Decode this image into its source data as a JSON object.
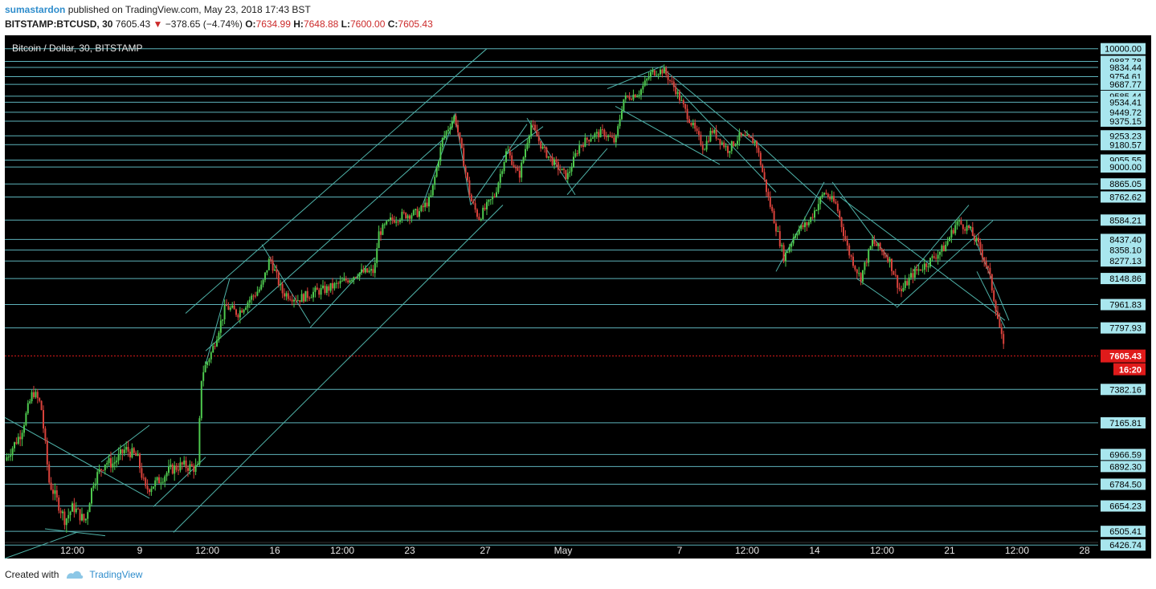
{
  "header": {
    "username": "sumastardon",
    "published_text": "published on TradingView.com, May 23, 2018 17:43 BST",
    "symbol": "BITSTAMP:BTCUSD, 30",
    "last": "7605.43",
    "change": "−378.65 (−4.74%)",
    "o_label": "O:",
    "o_value": "7634.99",
    "h_label": "H:",
    "h_value": "7648.88",
    "l_label": "L:",
    "l_value": "7600.00",
    "c_label": "C:",
    "c_value": "7605.43"
  },
  "footer": {
    "created_with": "Created with",
    "brand": "TradingView"
  },
  "colors": {
    "background": "#000000",
    "level_line": "#6fd3dc",
    "trend_line": "#4fb3a9",
    "label_bg": "#a8e6ee",
    "up": "#4ec94e",
    "down": "#d9423b",
    "price_tag": "#e01b1b"
  },
  "chart_data": {
    "type": "candlestick",
    "title": "Bitcoin / Dollar, 30, BITSTAMP",
    "ylim": [
      6350,
      10120
    ],
    "current_price": "7605.43",
    "countdown": "16:20",
    "price_levels": [
      "10000.00",
      "9887.78",
      "9834.44",
      "9754.61",
      "9687.77",
      "9585.44",
      "9534.41",
      "9449.72",
      "9375.15",
      "9253.23",
      "9180.57",
      "9055.55",
      "9000.00",
      "8865.05",
      "8762.62",
      "8584.21",
      "8437.40",
      "8358.10",
      "8277.13",
      "8148.86",
      "7961.83",
      "7797.93",
      "7382.16",
      "7165.81",
      "6966.59",
      "6892.30",
      "6784.50",
      "6654.23",
      "6505.41",
      "6426.74"
    ],
    "x_ticks": [
      "12:00",
      "9",
      "12:00",
      "16",
      "12:00",
      "23",
      "27",
      "May",
      "7",
      "12:00",
      "14",
      "12:00",
      "21",
      "12:00",
      "28"
    ],
    "price_path": [
      [
        0.0,
        6930
      ],
      [
        0.02,
        7100
      ],
      [
        0.035,
        7370
      ],
      [
        0.045,
        7280
      ],
      [
        0.055,
        6800
      ],
      [
        0.075,
        6570
      ],
      [
        0.085,
        6650
      ],
      [
        0.1,
        6560
      ],
      [
        0.11,
        6800
      ],
      [
        0.125,
        6920
      ],
      [
        0.135,
        6910
      ],
      [
        0.15,
        7000
      ],
      [
        0.165,
        6950
      ],
      [
        0.175,
        6750
      ],
      [
        0.19,
        6800
      ],
      [
        0.205,
        6870
      ],
      [
        0.22,
        6900
      ],
      [
        0.24,
        6880
      ],
      [
        0.245,
        7480
      ],
      [
        0.258,
        7640
      ],
      [
        0.275,
        7950
      ],
      [
        0.29,
        7900
      ],
      [
        0.305,
        8000
      ],
      [
        0.32,
        8090
      ],
      [
        0.33,
        8300
      ],
      [
        0.345,
        8050
      ],
      [
        0.365,
        8000
      ],
      [
        0.385,
        8050
      ],
      [
        0.4,
        8070
      ],
      [
        0.42,
        8120
      ],
      [
        0.44,
        8190
      ],
      [
        0.46,
        8200
      ],
      [
        0.465,
        8480
      ],
      [
        0.48,
        8580
      ],
      [
        0.495,
        8620
      ],
      [
        0.515,
        8640
      ],
      [
        0.53,
        8750
      ],
      [
        0.545,
        9230
      ],
      [
        0.56,
        9420
      ],
      [
        0.58,
        8740
      ],
      [
        0.59,
        8600
      ],
      [
        0.61,
        8780
      ],
      [
        0.625,
        9140
      ],
      [
        0.64,
        8920
      ],
      [
        0.655,
        9350
      ],
      [
        0.67,
        9140
      ],
      [
        0.685,
        9020
      ],
      [
        0.7,
        8920
      ],
      [
        0.715,
        9170
      ],
      [
        0.73,
        9250
      ],
      [
        0.745,
        9280
      ],
      [
        0.76,
        9200
      ],
      [
        0.77,
        9560
      ],
      [
        0.79,
        9620
      ],
      [
        0.805,
        9790
      ],
      [
        0.82,
        9810
      ],
      [
        0.835,
        9640
      ],
      [
        0.85,
        9420
      ],
      [
        0.87,
        9150
      ],
      [
        0.88,
        9300
      ],
      [
        0.9,
        9140
      ],
      [
        0.915,
        9250
      ],
      [
        0.935,
        9200
      ],
      [
        0.95,
        8760
      ],
      [
        0.97,
        8300
      ],
      [
        0.985,
        8500
      ],
      [
        1.0,
        8560
      ],
      [
        1.02,
        8800
      ],
      [
        1.035,
        8700
      ],
      [
        1.05,
        8350
      ],
      [
        1.065,
        8150
      ],
      [
        1.08,
        8420
      ],
      [
        1.1,
        8300
      ],
      [
        1.115,
        8050
      ],
      [
        1.13,
        8180
      ],
      [
        1.15,
        8270
      ],
      [
        1.17,
        8380
      ],
      [
        1.185,
        8570
      ],
      [
        1.2,
        8520
      ],
      [
        1.215,
        8360
      ],
      [
        1.225,
        8190
      ],
      [
        1.235,
        7900
      ],
      [
        1.245,
        7600
      ]
    ]
  }
}
